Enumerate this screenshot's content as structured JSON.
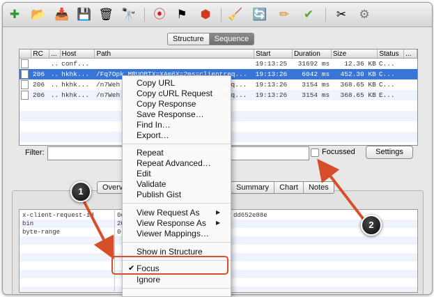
{
  "colors": {
    "selection": "#3875d7",
    "callout_arrow": "#d64f2a",
    "callout_badge": "#111111"
  },
  "toolbar": {
    "icons": [
      "add-icon",
      "open-folder-icon",
      "import-icon",
      "save-icon",
      "trash-icon",
      "binoculars-icon",
      "record-icon",
      "throttle-flag-icon",
      "stop-icon",
      "clear-icon",
      "refresh-icon",
      "edit-pencil-icon",
      "validate-check-icon",
      "tools-icon",
      "gear-icon"
    ],
    "glyphs": [
      "✚",
      "📂",
      "📥",
      "💾",
      "🗑",
      "🔭",
      "⦿",
      "⚑",
      "⬢",
      "🧹",
      "🔄",
      "✏",
      "✔",
      "✂",
      "⚙"
    ]
  },
  "view_toggle": {
    "structure": "Structure",
    "sequence": "Sequence"
  },
  "table": {
    "columns": [
      "",
      "RC",
      "...",
      "Host",
      "Path",
      "Start",
      "Duration",
      "Size",
      "Status",
      "..."
    ],
    "rows": [
      {
        "rc": "",
        "dots": "..",
        "host": "conf...",
        "path": "",
        "start": "19:13:25",
        "duration": "31692 ms",
        "size": "12.36 KB",
        "status": "C..."
      },
      {
        "rc": "206",
        "dots": "..",
        "host": "hkhk...",
        "path": "/Fq7Opk MRUOBTX=XAm6X=2ms=clientreq...",
        "start": "19:13:26",
        "duration": "6042 ms",
        "size": "452.30 KB",
        "status": "C..."
      },
      {
        "rc": "206",
        "dots": "..",
        "host": "hkhk...",
        "path": "/n7Weh",
        "path_end": "req...",
        "start": "19:13:26",
        "duration": "3154 ms",
        "size": "368.65 KB",
        "status": "C..."
      },
      {
        "rc": "206",
        "dots": "..",
        "host": "hkhk...",
        "path": "/n7Weh",
        "path_end": "req...",
        "start": "19:13:26",
        "duration": "3154 ms",
        "size": "368.65 KB",
        "status": "E..."
      }
    ]
  },
  "filter": {
    "label": "Filter:",
    "value": "",
    "focussed_label": "Focussed",
    "settings_label": "Settings"
  },
  "detail_tabs": {
    "overview": "Overvie",
    "summary": "Summary",
    "chart": "Chart",
    "notes": "Notes"
  },
  "detail": {
    "rows": [
      {
        "key": "x-client-request-id",
        "value": "0c",
        "value_end": "dd652e88e"
      },
      {
        "key": "bin",
        "value": "20"
      },
      {
        "key": "byte-range",
        "value": "0-"
      }
    ]
  },
  "context_menu": {
    "items": [
      "Copy URL",
      "Copy cURL Request",
      "Copy Response",
      "Save Response…",
      "Find In…",
      "Export…",
      "Repeat",
      "Repeat Advanced…",
      "Edit",
      "Validate",
      "Publish Gist",
      "View Request As",
      "View Response As",
      "Viewer Mappings…",
      "Show in Structure",
      "Focus",
      "Ignore"
    ],
    "focus_checked": true
  },
  "callouts": {
    "one": "1",
    "two": "2"
  }
}
